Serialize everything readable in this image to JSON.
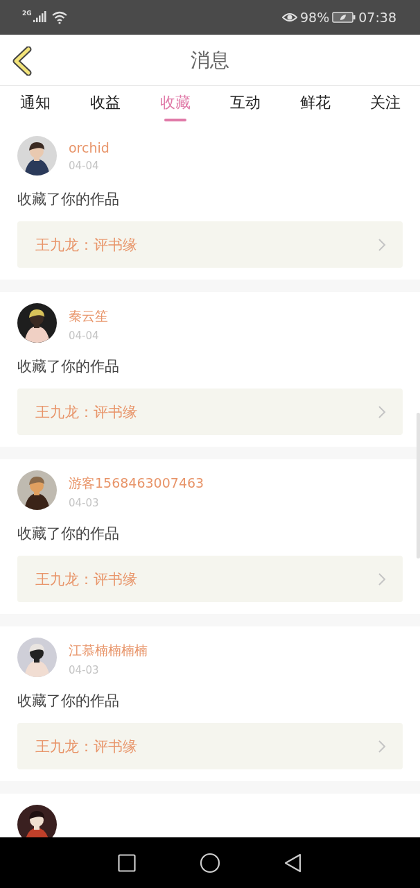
{
  "status_bar": {
    "network": "2G",
    "battery_percent": "98%",
    "time": "07:38"
  },
  "header": {
    "title": "消息"
  },
  "tabs": [
    {
      "label": "通知",
      "selected": false
    },
    {
      "label": "收益",
      "selected": false
    },
    {
      "label": "收藏",
      "selected": true
    },
    {
      "label": "互动",
      "selected": false
    },
    {
      "label": "鲜花",
      "selected": false
    },
    {
      "label": "关注",
      "selected": false
    }
  ],
  "messages": [
    {
      "kind": "message",
      "name": "orchid",
      "date": "04-04",
      "action": "收藏了你的作品",
      "work": "王九龙：评书缘"
    },
    {
      "kind": "message",
      "name": "秦云笙",
      "date": "04-04",
      "action": "收藏了你的作品",
      "work": "王九龙：评书缘"
    },
    {
      "kind": "message",
      "name": "游客1568463007463",
      "date": "04-03",
      "action": "收藏了你的作品",
      "work": "王九龙：评书缘"
    },
    {
      "kind": "message",
      "name": "江慕楠楠楠楠",
      "date": "04-03",
      "action": "收藏了你的作品",
      "work": "王九龙：评书缘"
    },
    {
      "kind": "cut_off"
    }
  ]
}
